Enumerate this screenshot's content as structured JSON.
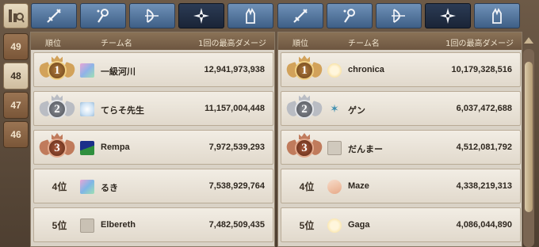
{
  "category_tabs": [
    {
      "icon": "sword-icon",
      "active": false
    },
    {
      "icon": "magic-staff-icon",
      "active": false
    },
    {
      "icon": "bow-icon",
      "active": false
    },
    {
      "icon": "shuriken-icon",
      "active": true
    },
    {
      "icon": "gauntlet-icon",
      "active": false
    }
  ],
  "rank_tabs": [
    {
      "label": "49",
      "active": false
    },
    {
      "label": "48",
      "active": true
    },
    {
      "label": "47",
      "active": false
    },
    {
      "label": "46",
      "active": false
    }
  ],
  "headers": {
    "rank": "順位",
    "team": "チーム名",
    "score": "1回の最高ダメージ"
  },
  "left_rows": [
    {
      "rank": "1",
      "medal": "gold",
      "team": "一級河川",
      "score": "12,941,973,938",
      "avatar": "#8fb3e8"
    },
    {
      "rank": "2",
      "medal": "silver",
      "team": "てらそ先生",
      "score": "11,157,004,448",
      "avatar": "#cfe3f5"
    },
    {
      "rank": "3",
      "medal": "bronze",
      "team": "Rempa",
      "score": "7,972,539,293",
      "avatar": "#2f8f3e"
    },
    {
      "rank": "4位",
      "medal": "",
      "team": "るき",
      "score": "7,538,929,764",
      "avatar": "#7fb6e6"
    },
    {
      "rank": "5位",
      "medal": "",
      "team": "Elbereth",
      "score": "7,482,509,435",
      "avatar": "#c9c1b4"
    }
  ],
  "right_rows": [
    {
      "rank": "1",
      "medal": "gold",
      "team": "chronica",
      "score": "10,179,328,516",
      "avatar": "#f3d27a"
    },
    {
      "rank": "2",
      "medal": "silver",
      "team": "ゲン",
      "score": "6,037,472,688",
      "avatar": "#e7eef2"
    },
    {
      "rank": "3",
      "medal": "bronze",
      "team": "だんまー",
      "score": "4,512,081,792",
      "avatar": "#d0c9bd"
    },
    {
      "rank": "4位",
      "medal": "",
      "team": "Maze",
      "score": "4,338,219,313",
      "avatar": "#f0c3a8"
    },
    {
      "rank": "5位",
      "medal": "",
      "team": "Gaga",
      "score": "4,086,044,890",
      "avatar": "#f6d98a"
    }
  ]
}
